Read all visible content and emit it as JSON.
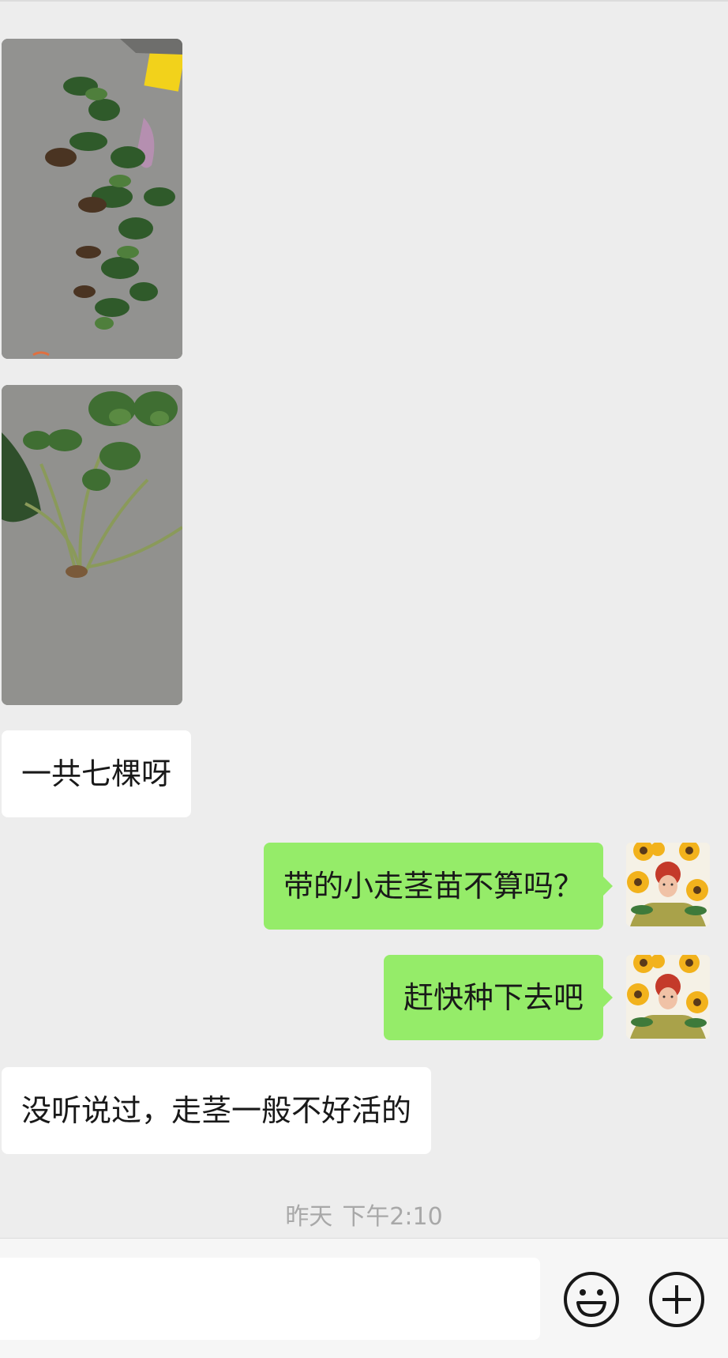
{
  "messages": {
    "m1_text": "一共七棵呀",
    "m2_text": "带的小走茎苗不算吗？",
    "m3_text": "赶快种下去吧",
    "m4_text": "没听说过，走茎一般不好活的"
  },
  "timestamp": {
    "day": "昨天",
    "time": "下午2:10"
  },
  "composer": {
    "emoji_icon": "smiley-icon",
    "plus_icon": "plus-circle-icon"
  },
  "colors": {
    "background": "#ededed",
    "outgoing_bubble": "#95ec69",
    "incoming_bubble": "#ffffff"
  }
}
